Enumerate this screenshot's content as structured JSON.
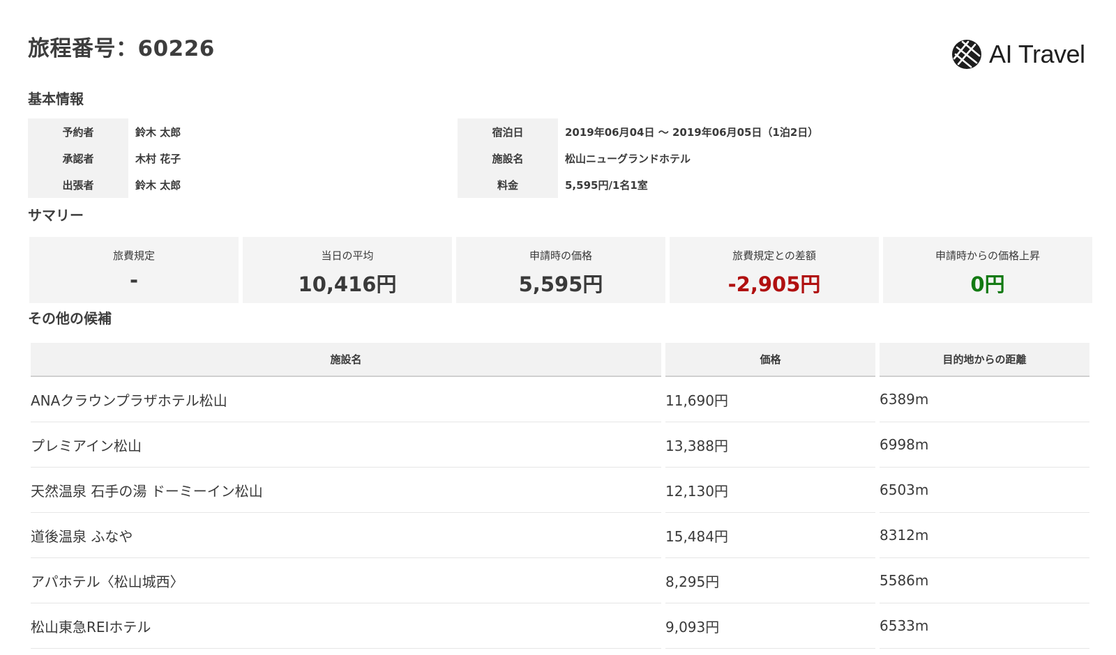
{
  "header": {
    "title": "旅程番号：60226",
    "logo_text": "AI Travel",
    "logo_icon": "globe-icon"
  },
  "basic_info": {
    "heading": "基本情報",
    "left": [
      {
        "label": "予約者",
        "value": "鈴木 太郎"
      },
      {
        "label": "承認者",
        "value": "木村 花子"
      },
      {
        "label": "出張者",
        "value": "鈴木 太郎"
      }
    ],
    "right": [
      {
        "label": "宿泊日",
        "value": "2019年06月04日 〜 2019年06月05日（1泊2日）"
      },
      {
        "label": "施設名",
        "value": "松山ニューグランドホテル"
      },
      {
        "label": "料金",
        "value": "5,595円/1名1室"
      }
    ]
  },
  "summary": {
    "heading": "サマリー",
    "cards": [
      {
        "label": "旅費規定",
        "value": "-"
      },
      {
        "label": "当日の平均",
        "value": "10,416円"
      },
      {
        "label": "申請時の価格",
        "value": "5,595円"
      },
      {
        "label": "旅費規定との差額",
        "value": "-2,905円"
      },
      {
        "label": "申請時からの価格上昇",
        "value": "0円"
      }
    ],
    "colors": {
      "negative": "#b01010",
      "positive": "#137a13"
    }
  },
  "candidates": {
    "heading": "その他の候補",
    "columns": [
      "施設名",
      "価格",
      "目的地からの距離"
    ],
    "rows": [
      [
        "ANAクラウンプラザホテル松山",
        "11,690円",
        "6389m"
      ],
      [
        "プレミアイン松山",
        "13,388円",
        "6998m"
      ],
      [
        "天然温泉 石手の湯 ドーミーイン松山",
        "12,130円",
        "6503m"
      ],
      [
        "道後温泉 ふなや",
        "15,484円",
        "8312m"
      ],
      [
        "アパホテル〈松山城西〉",
        "8,295円",
        "5586m"
      ],
      [
        "松山東急REIホテル",
        "9,093円",
        "6533m"
      ]
    ]
  }
}
